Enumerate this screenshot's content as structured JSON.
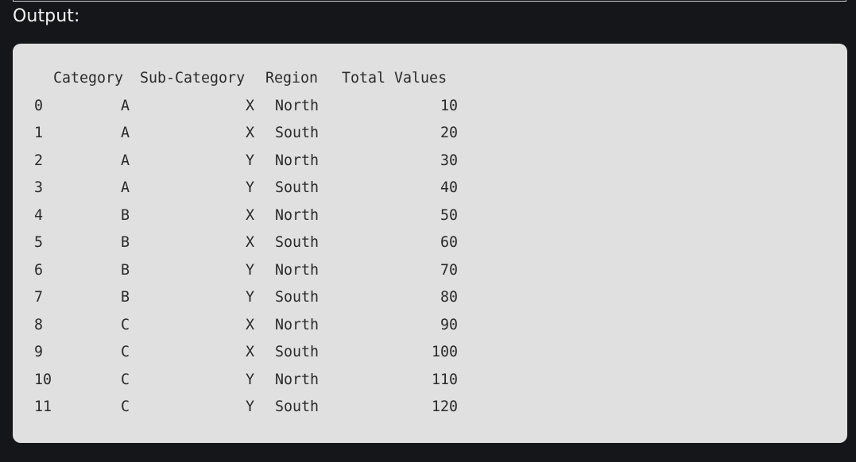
{
  "output_label": "Output:",
  "table": {
    "headers": {
      "category": "Category",
      "sub_category": "Sub-Category",
      "region": "Region",
      "total_values": "Total Values"
    },
    "rows": [
      {
        "index": "0",
        "category": "A",
        "sub_category": "X",
        "region": "North",
        "total_values": "10"
      },
      {
        "index": "1",
        "category": "A",
        "sub_category": "X",
        "region": "South",
        "total_values": "20"
      },
      {
        "index": "2",
        "category": "A",
        "sub_category": "Y",
        "region": "North",
        "total_values": "30"
      },
      {
        "index": "3",
        "category": "A",
        "sub_category": "Y",
        "region": "South",
        "total_values": "40"
      },
      {
        "index": "4",
        "category": "B",
        "sub_category": "X",
        "region": "North",
        "total_values": "50"
      },
      {
        "index": "5",
        "category": "B",
        "sub_category": "X",
        "region": "South",
        "total_values": "60"
      },
      {
        "index": "6",
        "category": "B",
        "sub_category": "Y",
        "region": "North",
        "total_values": "70"
      },
      {
        "index": "7",
        "category": "B",
        "sub_category": "Y",
        "region": "South",
        "total_values": "80"
      },
      {
        "index": "8",
        "category": "C",
        "sub_category": "X",
        "region": "North",
        "total_values": "90"
      },
      {
        "index": "9",
        "category": "C",
        "sub_category": "X",
        "region": "South",
        "total_values": "100"
      },
      {
        "index": "10",
        "category": "C",
        "sub_category": "Y",
        "region": "North",
        "total_values": "110"
      },
      {
        "index": "11",
        "category": "C",
        "sub_category": "Y",
        "region": "South",
        "total_values": "120"
      }
    ]
  }
}
